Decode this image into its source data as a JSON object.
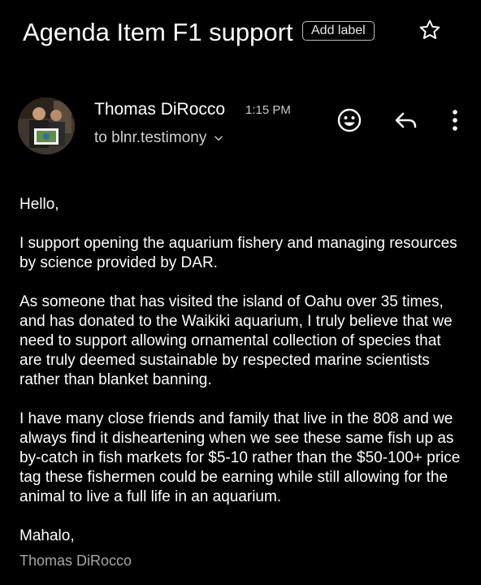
{
  "message": {
    "subject": "Agenda Item F1 support",
    "add_label": "Add label",
    "sender": "Thomas DiRocco",
    "time": "1:15 PM",
    "recipient": "to blnr.testimony",
    "body": {
      "greeting": "Hello,",
      "paragraph_1": "I support opening the aquarium fishery and managing resources by science provided by DAR.",
      "paragraph_2": "As someone that has visited the island of Oahu over 35 times, and has donated to the Waikiki aquarium, I truly believe that we need to support allowing ornamental collection of species that are truly deemed sustainable by respected marine scientists rather than blanket banning.",
      "paragraph_3": "I have many close friends and family that live in the 808 and we always find it disheartening when we see these same fish up as by-catch in fish markets for $5-10 rather than the $50-100+ price tag these fishermen could be earning while still allowing for the animal to live a full life in an aquarium.",
      "closing": "Mahalo,"
    },
    "signature": "Thomas DiRocco"
  },
  "icons": {
    "star": "star-icon",
    "recipient_chevron": "chevron-down-icon",
    "emoji_react": "emoji-icon",
    "reply": "reply-icon",
    "more": "more-vert-icon"
  },
  "colors": {
    "background": "#000000",
    "text": "#ffffff",
    "secondary_text": "#c8c8c8",
    "signature_text": "#a6a6a6"
  }
}
